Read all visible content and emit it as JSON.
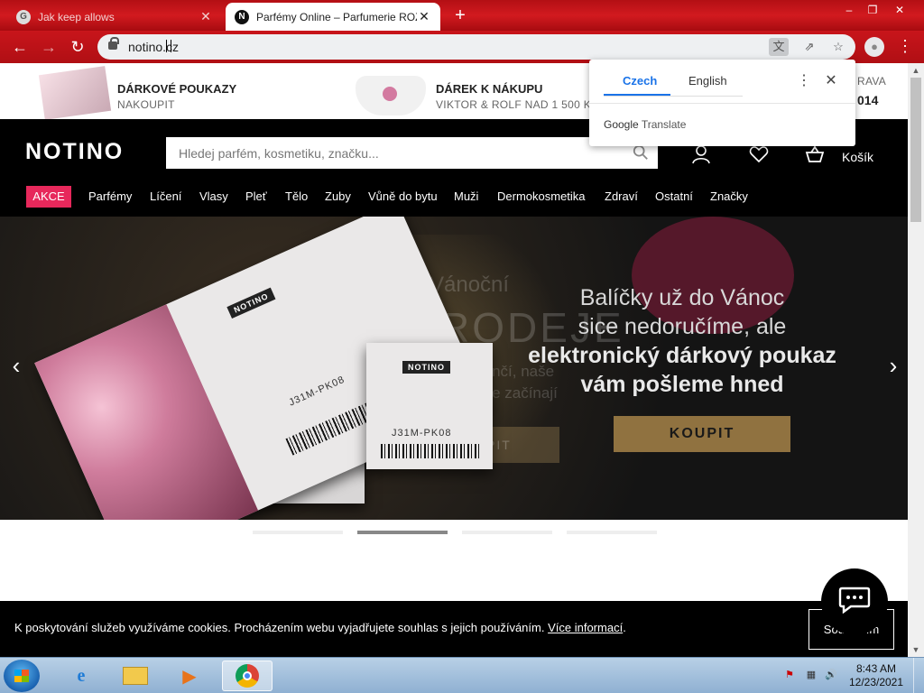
{
  "browser": {
    "tabs": [
      {
        "title": "Jak keep allows",
        "favicon": "G",
        "active": false
      },
      {
        "title": "Parfémy Online – Parfumerie ROZ",
        "favicon": "N",
        "active": true
      }
    ],
    "url": "notino.cz",
    "window_controls": {
      "minimize": "–",
      "maximize": "❐",
      "close": "✕"
    },
    "icons": [
      "back-icon",
      "forward-icon",
      "reload-icon",
      "lock-icon",
      "translate-icon",
      "share-icon",
      "star-icon",
      "profile-icon",
      "menu-icon"
    ]
  },
  "translate_popup": {
    "source_lang": "Czech",
    "target_lang": "English",
    "brand": "Google",
    "brand_suffix": "Translate"
  },
  "promo_strip": {
    "items": [
      {
        "title": "DÁRKOVÉ POUKAZY",
        "subtitle": "NAKOUPIT"
      },
      {
        "title": "DÁREK K NÁKUPU",
        "subtitle": "VIKTOR & ROLF NAD 1 500 KČ"
      },
      {
        "title": "RAVA",
        "subtitle": "014"
      }
    ]
  },
  "header": {
    "logo": "NOTINO",
    "search_placeholder": "Hledej parfém, kosmetiku, značku...",
    "cart_label": "Košík"
  },
  "nav": {
    "highlight": "AKCE",
    "items": [
      "Parfémy",
      "Líčení",
      "Vlasy",
      "Pleť",
      "Tělo",
      "Zuby",
      "Vůně do bytu",
      "Muži",
      "Dermokosmetika",
      "Zdraví",
      "Ostatní",
      "Značky"
    ]
  },
  "hero": {
    "line1": "Balíčky už do Vánoc",
    "line2": "sice nedoručíme, ale",
    "line3": "elektronický dárkový poukaz",
    "line4": "vám pošleme hned",
    "cta": "KOUPIT",
    "ghost_title_small": "Vánoční",
    "ghost_title_big": "VÝPRODEJE",
    "ghost_line1": "Tento rok pomalu končí, naše",
    "ghost_line2": "velké slevy ale teprve začínají",
    "ghost_cta": "NAKOUPIT",
    "card_logo": "NOTINO",
    "card_code": "J31M-PK08",
    "slides_count": 4,
    "active_slide": 2
  },
  "cookie_bar": {
    "text": "K poskytování služeb využíváme cookies. Procházením webu vyjadřujete souhlas s jejich používáním.",
    "link": "Více informací",
    "after_link": ".",
    "button": "Souhlasím"
  },
  "taskbar": {
    "apps": [
      "internet-explorer",
      "file-explorer",
      "media-player",
      "chrome"
    ],
    "active_app": "chrome",
    "time": "8:43 AM",
    "date": "12/23/2021"
  }
}
